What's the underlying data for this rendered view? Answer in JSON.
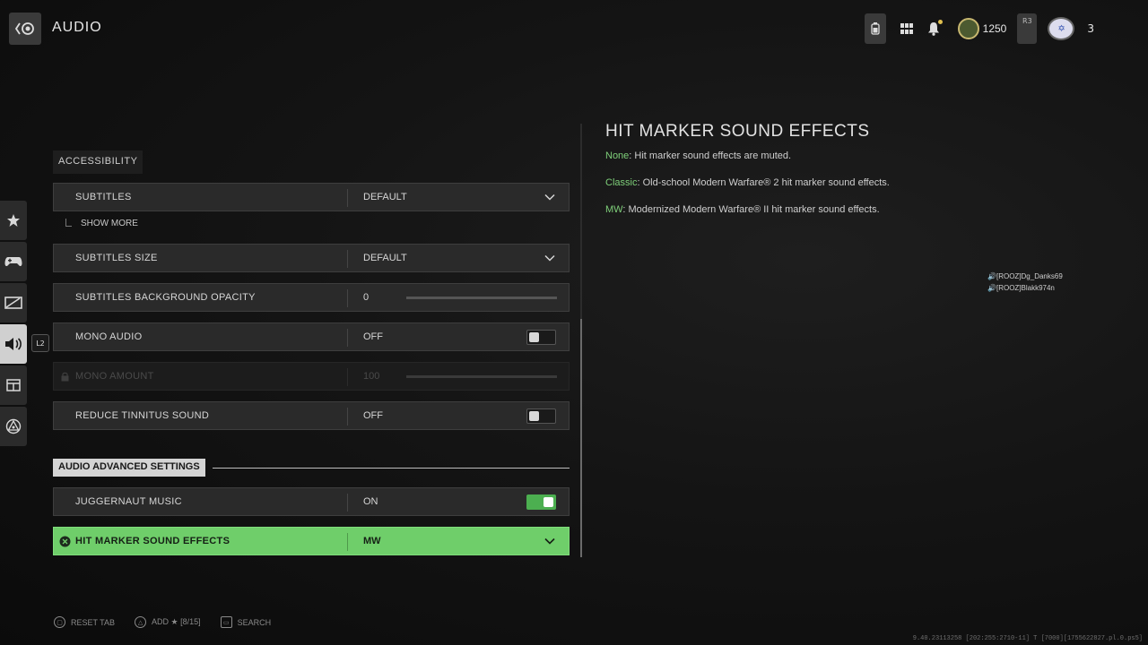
{
  "header": {
    "title": "AUDIO",
    "cod_points": "1250",
    "party_count": "3",
    "r3_label": "R3"
  },
  "sidenav": {
    "items": [
      {
        "icon": "star-icon"
      },
      {
        "icon": "controller-icon"
      },
      {
        "icon": "graphics-icon"
      },
      {
        "icon": "speaker-icon",
        "active": true
      },
      {
        "icon": "interface-icon"
      },
      {
        "icon": "network-icon"
      }
    ],
    "active_badge": "L2"
  },
  "accessibility": {
    "section_label": "ACCESSIBILITY",
    "subtitles": {
      "label": "SUBTITLES",
      "value": "DEFAULT"
    },
    "show_more": "SHOW MORE",
    "subtitles_size": {
      "label": "SUBTITLES SIZE",
      "value": "DEFAULT"
    },
    "subtitles_bg_opacity": {
      "label": "SUBTITLES BACKGROUND OPACITY",
      "value": "0",
      "level": 0
    },
    "mono_audio": {
      "label": "MONO AUDIO",
      "value": "OFF",
      "on": false
    },
    "mono_amount": {
      "label": "MONO AMOUNT",
      "value": "100",
      "level": 1.0,
      "disabled": true
    },
    "reduce_tinnitus": {
      "label": "REDUCE TINNITUS SOUND",
      "value": "OFF",
      "on": false
    }
  },
  "advanced": {
    "section_label": "AUDIO ADVANCED SETTINGS",
    "juggernaut_music": {
      "label": "JUGGERNAUT MUSIC",
      "value": "ON",
      "on": true
    },
    "hit_marker": {
      "label": "HIT MARKER SOUND EFFECTS",
      "value": "MW",
      "selected": true
    }
  },
  "info_panel": {
    "title": "HIT MARKER SOUND EFFECTS",
    "lines": [
      {
        "key": "None",
        "text": ": Hit marker sound effects are muted."
      },
      {
        "key": "Classic",
        "text": ": Old-school Modern Warfare® 2 hit marker sound effects."
      },
      {
        "key": "MW",
        "text": ": Modernized Modern Warfare® II hit marker sound effects."
      }
    ]
  },
  "voice_chat": {
    "players": [
      "[ROOZ]Dg_Danks69",
      "[ROOZ]Blakk974n"
    ]
  },
  "footer": {
    "reset": "RESET TAB",
    "add": "ADD ★ [8/15]",
    "search": "SEARCH"
  },
  "build_info": "9.40.23113258 [202:255:2710-11] T [7000][1755622827.pl.0.ps5]",
  "colors": {
    "accent_green": "#6fce6a",
    "toggle_on": "#4caf50",
    "key_green": "#7fd07a"
  }
}
